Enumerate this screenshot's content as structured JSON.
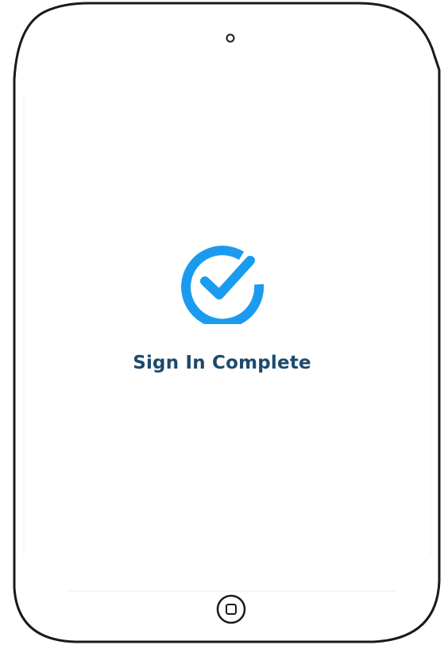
{
  "status": {
    "message": "Sign In Complete",
    "icon": "check-circle-icon",
    "accent_color": "#1a9bf0",
    "text_color": "#1d4a6b"
  },
  "device": {
    "frame_color": "#1a1a1a",
    "camera_icon": "camera-icon",
    "home_button_icon": "home-button-icon"
  }
}
